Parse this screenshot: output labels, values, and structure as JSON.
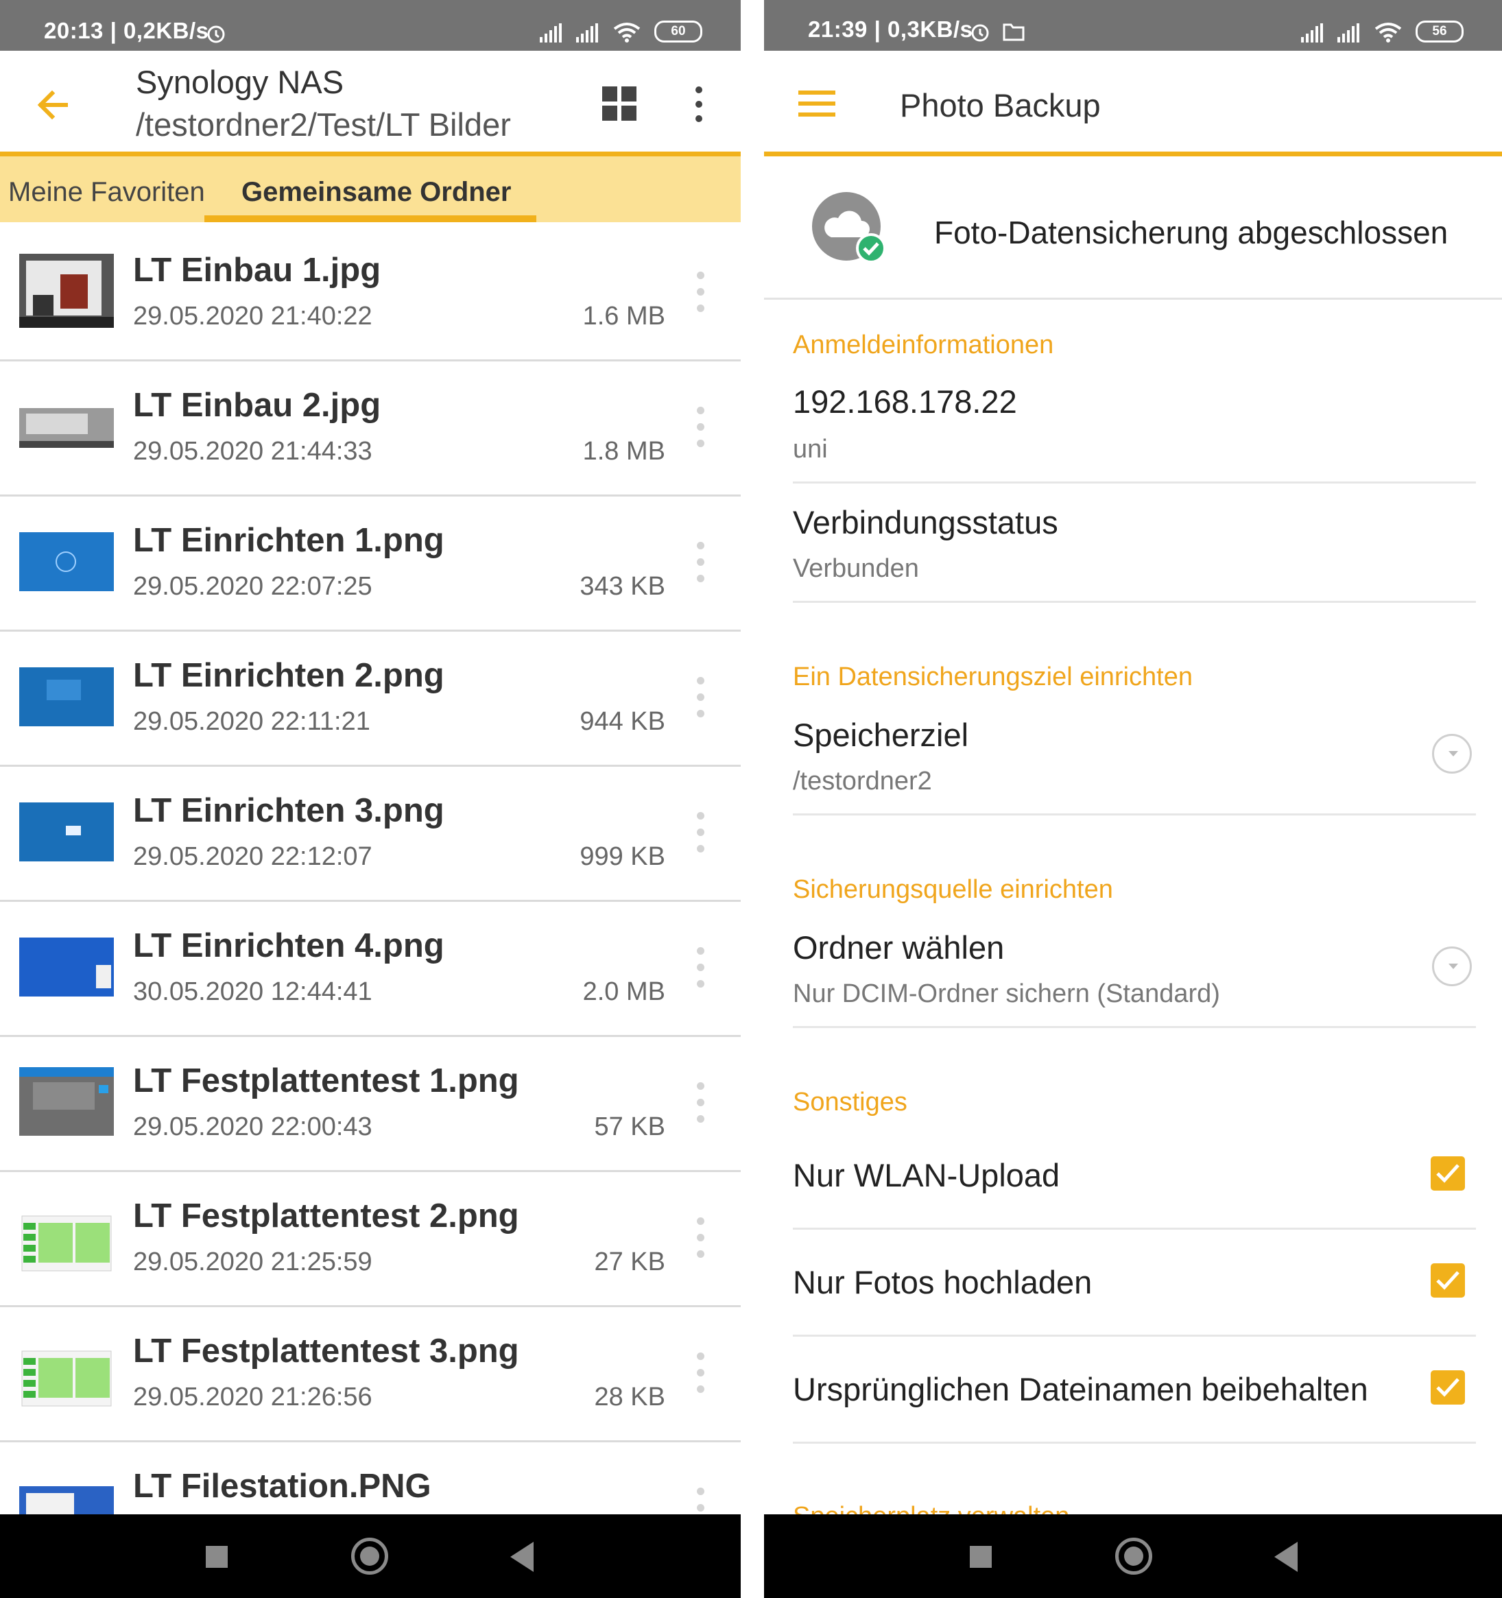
{
  "left": {
    "status_bar": {
      "text": "20:13 | 0,2KB/s",
      "battery": "60"
    },
    "toolbar": {
      "title": "Synology NAS",
      "path": "/testordner2/Test/LT Bilder"
    },
    "tabs": [
      {
        "label": "Meine Favoriten"
      },
      {
        "label": "Gemeinsame Ordner"
      }
    ],
    "files": [
      {
        "name": "LT Einbau 1.jpg",
        "date": "29.05.2020 21:40:22",
        "size": "1.6 MB"
      },
      {
        "name": "LT Einbau 2.jpg",
        "date": "29.05.2020 21:44:33",
        "size": "1.8 MB"
      },
      {
        "name": "LT Einrichten 1.png",
        "date": "29.05.2020 22:07:25",
        "size": "343 KB"
      },
      {
        "name": "LT Einrichten 2.png",
        "date": "29.05.2020 22:11:21",
        "size": "944 KB"
      },
      {
        "name": "LT Einrichten 3.png",
        "date": "29.05.2020 22:12:07",
        "size": "999 KB"
      },
      {
        "name": "LT Einrichten 4.png",
        "date": "30.05.2020 12:44:41",
        "size": "2.0 MB"
      },
      {
        "name": "LT Festplattentest 1.png",
        "date": "29.05.2020 22:00:43",
        "size": "57 KB"
      },
      {
        "name": "LT Festplattentest 2.png",
        "date": "29.05.2020 21:25:59",
        "size": "27 KB"
      },
      {
        "name": "LT Festplattentest 3.png",
        "date": "29.05.2020 21:26:56",
        "size": "28 KB"
      },
      {
        "name": "LT Filestation.PNG"
      }
    ]
  },
  "right": {
    "status_bar": {
      "text": "21:39 | 0,3KB/s",
      "battery": "56"
    },
    "toolbar": {
      "title": "Photo Backup"
    },
    "backup_status": "Foto-Datensicherung abgeschlossen",
    "credentials": {
      "header": "Anmeldeinformationen",
      "ip": "192.168.178.22",
      "user": "uni"
    },
    "connection": {
      "title": "Verbindungsstatus",
      "value": "Verbunden"
    },
    "target": {
      "header": "Ein Datensicherungsziel einrichten",
      "title": "Speicherziel",
      "value": "/testordner2"
    },
    "source": {
      "header": "Sicherungsquelle einrichten",
      "title": "Ordner wählen",
      "value": "Nur DCIM-Ordner sichern (Standard)"
    },
    "misc": {
      "header": "Sonstiges",
      "options": [
        {
          "label": "Nur WLAN-Upload",
          "checked": true
        },
        {
          "label": "Nur Fotos hochladen",
          "checked": true
        },
        {
          "label": "Ursprünglichen Dateinamen beibehalten",
          "checked": true
        }
      ]
    },
    "next_section_partial": "Speicherplatz verwalten"
  },
  "colors": {
    "accent": "#f1b11b",
    "tab_bg": "#fbe195",
    "header_orange": "#f0a51c",
    "statusbar": "#737373",
    "check_green": "#2fb26f"
  }
}
